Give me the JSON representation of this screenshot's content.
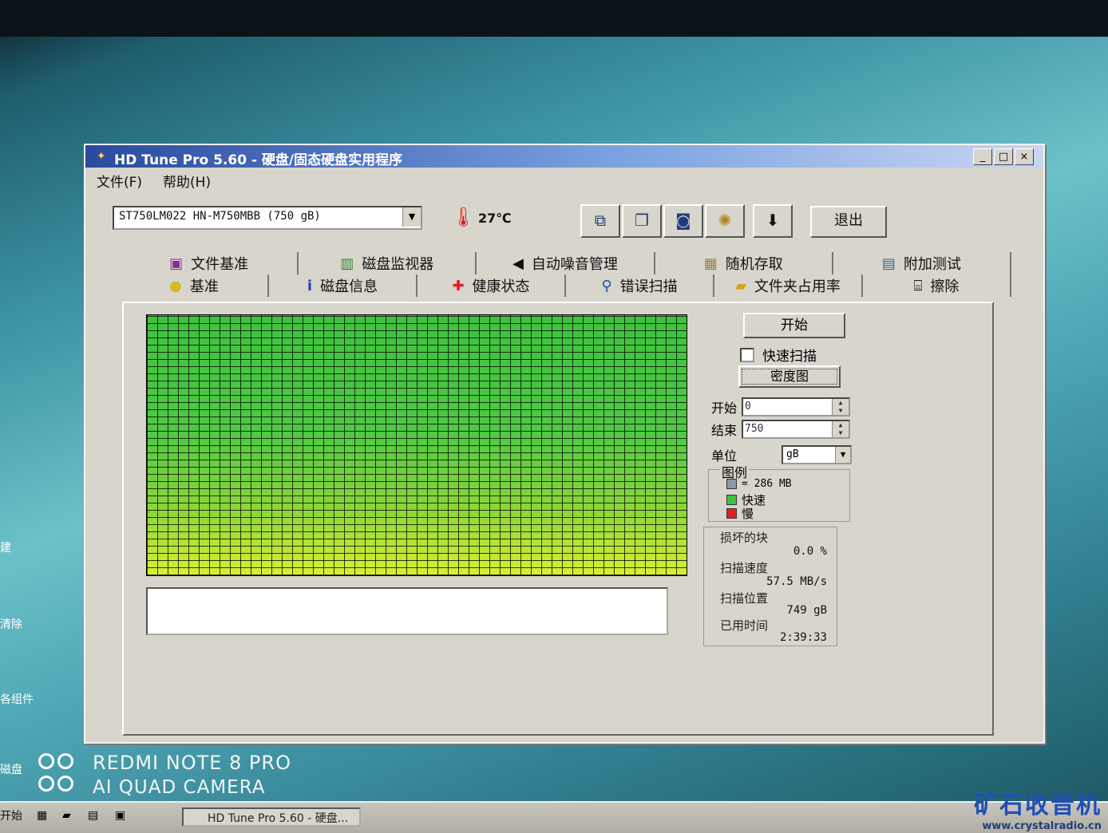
{
  "window": {
    "title": "HD Tune Pro 5.60 - 硬盘/固态硬盘实用程序",
    "controls": {
      "minimize": "_",
      "maximize": "□",
      "close": "×"
    }
  },
  "menu": [
    "文件(F)",
    "帮助(H)"
  ],
  "toolbar": {
    "drive": "ST750LM022 HN-M750MBB (750 gB)",
    "temperature": "27℃",
    "exit_label": "退出",
    "icons": [
      "copy-text-icon",
      "copy-screen-icon",
      "camera-icon",
      "options-icon",
      "save-download-icon"
    ]
  },
  "tabs_top": [
    {
      "label": "文件基准",
      "icon": "file-benchmark-icon"
    },
    {
      "label": "磁盘监视器",
      "icon": "disk-monitor-icon"
    },
    {
      "label": "自动噪音管理",
      "icon": "speaker-icon"
    },
    {
      "label": "随机存取",
      "icon": "random-access-icon"
    },
    {
      "label": "附加测试",
      "icon": "extra-tests-icon"
    }
  ],
  "tabs_bottom": [
    {
      "label": "基准",
      "icon": "benchmark-bulb-icon"
    },
    {
      "label": "磁盘信息",
      "icon": "info-icon"
    },
    {
      "label": "健康状态",
      "icon": "health-cross-icon"
    },
    {
      "label": "错误扫描",
      "icon": "magnifier-icon",
      "active": true
    },
    {
      "label": "文件夹占用率",
      "icon": "folder-icon"
    },
    {
      "label": "擦除",
      "icon": "trash-icon"
    }
  ],
  "scan": {
    "start_button": "开始",
    "quick_scan_label": "快速扫描",
    "quick_scan_checked": false,
    "map_button": "密度图",
    "start_label": "开始",
    "start_value": "0",
    "end_label": "结束",
    "end_value": "750",
    "unit_label": "单位",
    "unit_value": "gB",
    "legend_title": "图例",
    "legend": [
      {
        "label": "= 286 MB",
        "color": "#8a9aa8"
      },
      {
        "label": "快速",
        "color": "#3fc23f"
      },
      {
        "label": "慢",
        "color": "#e02020"
      }
    ],
    "damaged_label": "损坏的块",
    "damaged_value": "0.0 %",
    "speed_label": "扫描速度",
    "speed_value": "57.5 MB/s",
    "position_label": "扫描位置",
    "position_value": "749 gB",
    "elapsed_label": "已用时间",
    "elapsed_value": "2:39:33",
    "progress": 1.0
  },
  "watermark": {
    "line1": "REDMI NOTE 8 PRO",
    "line2": "AI QUAD CAMERA"
  },
  "taskbar": {
    "start": "开始",
    "task": "HD Tune Pro 5.60 - 硬盘..."
  },
  "brand": {
    "name": "矿石收音机",
    "url": "www.crystalradio.cn"
  },
  "desktop_labels": [
    "建",
    "清除",
    "各组件",
    "磁盘"
  ]
}
